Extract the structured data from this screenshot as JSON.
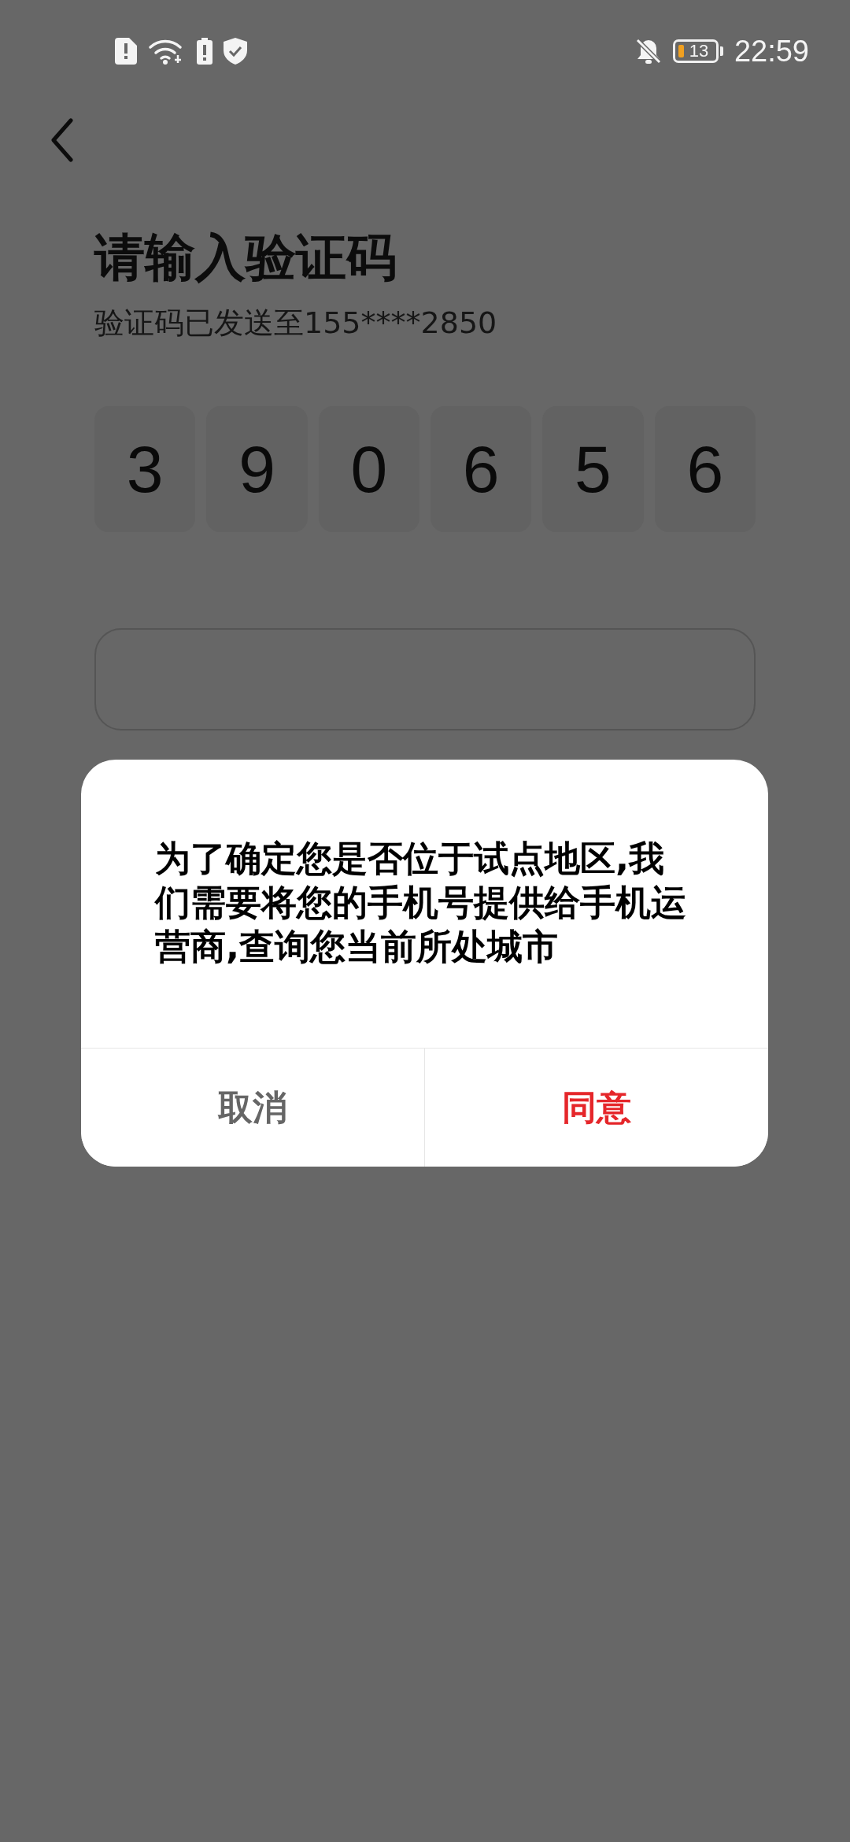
{
  "status_bar": {
    "time": "22:59",
    "battery": "13"
  },
  "title": "请输入验证码",
  "subtitle": "验证码已发送至155****2850",
  "code_digits": [
    "3",
    "9",
    "0",
    "6",
    "5",
    "6"
  ],
  "dialog": {
    "message": "为了确定您是否位于试点地区,我们需要将您的手机号提供给手机运营商,查询您当前所处城市",
    "buttons": [
      {
        "label": "取消",
        "kind": "cancel"
      },
      {
        "label": "同意",
        "kind": "confirm"
      }
    ]
  }
}
